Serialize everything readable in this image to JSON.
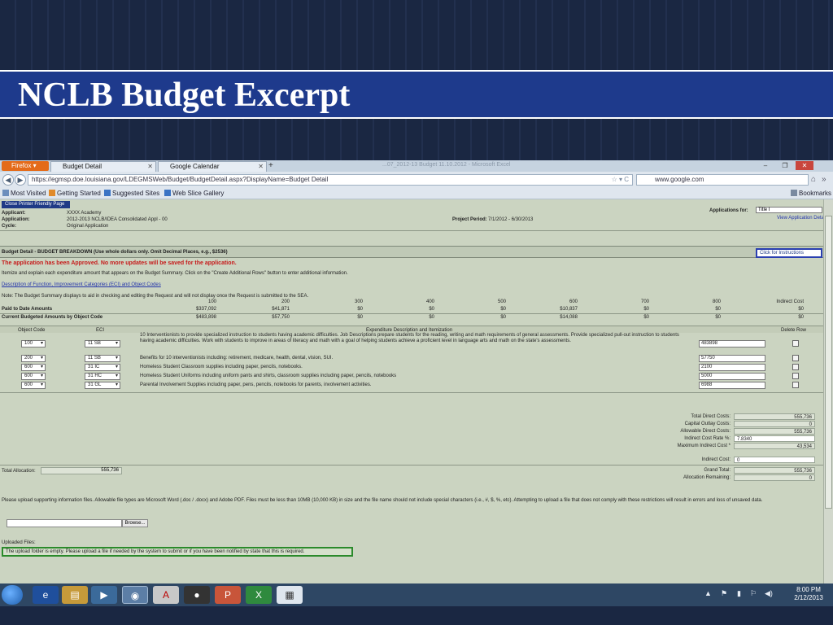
{
  "slide": {
    "title": "NCLB Budget Excerpt"
  },
  "browser": {
    "firefox_button": "Firefox",
    "tabs": [
      {
        "label": "Budget Detail"
      },
      {
        "label": "Google Calendar"
      }
    ],
    "new_tab": "+",
    "window_title": "...07_2012-13 Budget 11.10.2012 - Microsoft Excel",
    "controls": {
      "minimize": "–",
      "restore": "❐",
      "close": "✕"
    },
    "url": "https://egmsp.doe.louisiana.gov/LDEGMSWeb/Budget/BudgetDetail.aspx?DisplayName=Budget Detail",
    "search": "www.google.com",
    "bookmarks": [
      {
        "label": "Most Visited"
      },
      {
        "label": "Getting Started"
      },
      {
        "label": "Suggested Sites"
      },
      {
        "label": "Web Slice Gallery"
      }
    ],
    "bookmarks_menu": "Bookmarks"
  },
  "page": {
    "print_button": "Close Printer Friendly Page",
    "applicant_label": "Applicant:",
    "applicant_value": "XXXX Academy",
    "application_label": "Application:",
    "application_value": "2012-2013 NCLB/IDEA Consolidated Appl - 00",
    "cycle_label": "Cycle:",
    "cycle_value": "Original Application",
    "project_period_label": "Project Period:",
    "project_period_value": "7/1/2012 - 6/30/2013",
    "applications_for_label": "Applications for:",
    "applications_for_value": "Title I",
    "view_link": "View Application Details",
    "section_title": "Budget Detail   -   BUDGET BREAKDOWN (Use whole dollars only.  Omit Decimal Places, e.g., $2536)",
    "instructions_link": "Click for Instructions",
    "approved_msg": "The application has been Approved. No more updates will be saved for the application.",
    "instruction_text": "Itemize and explain each expenditure amount that appears on the Budget Summary.  Click on the \"Create Additional Rows\" button to enter additional information.",
    "description_link": "Description of Function, Improvement Categories (ECI) and Object Codes",
    "note_text": "Note: The Budget Summary displays to aid in checking and editing the Request and will not display once the Request is submitted to the SEA.",
    "object_codes": [
      "100",
      "200",
      "300",
      "400",
      "500",
      "600",
      "700",
      "800",
      "Indirect Cost"
    ],
    "paid_label": "Paid to Date Amounts",
    "paid_values": [
      "$337,092",
      "$41,871",
      "$0",
      "$0",
      "$0",
      "$10,837",
      "$0",
      "$0",
      "$0"
    ],
    "budgeted_label": "Current Budgeted Amounts by Object Code",
    "budgeted_values": [
      "$483,898",
      "$57,750",
      "$0",
      "$0",
      "$0",
      "$14,088",
      "$0",
      "$0",
      "$0"
    ],
    "table_headers": {
      "object_code": "Object Code",
      "eci": "ECI",
      "expenditure": "Expenditure Description and Itemization",
      "delete": "Delete Row"
    },
    "rows": [
      {
        "object": "100",
        "eci": "11 SB",
        "description": "10 Interventionists to provide specialized instruction to students having academic difficulties. Job Descriptions prepare students for the reading, writing and math requirements of general assessments. Provide specialized pull-out instruction to students having academic difficulties. Work with students to improve in areas of literacy and math with a goal of helping students achieve a proficient level in language arts and math on the state's assessments.",
        "amount": "483898"
      },
      {
        "object": "200",
        "eci": "11 SB",
        "description": "Benefits for 10 interventionists including: retirement, medicare, health, dental, vision, SUI.",
        "amount": "57750"
      },
      {
        "object": "600",
        "eci": "31 IC",
        "description": "Homeless Student Classroom supplies including paper, pencils, notebooks.",
        "amount": "2100"
      },
      {
        "object": "600",
        "eci": "31 HC",
        "description": "Homeless Student Uniforms including uniform pants and shirts, classroom supplies including paper, pencils, notebooks",
        "amount": "5000"
      },
      {
        "object": "600",
        "eci": "31 GL",
        "description": "Parental Involvement Supplies including paper, pens, pencils, notebooks for parents, involvement activities.",
        "amount": "6988"
      }
    ],
    "summary": [
      {
        "label": "Total Direct Costs:",
        "value": "555,736"
      },
      {
        "label": "Capital Outlay Costs:",
        "value": "0"
      },
      {
        "label": "Allowable Direct Costs:",
        "value": "555,736"
      },
      {
        "label": "Indirect Cost Rate %:",
        "value": "7.8340"
      },
      {
        "label": "Maximum Indirect Cost *",
        "value": "43,534"
      }
    ],
    "indirect_label": "Indirect Cost:",
    "indirect_value": "0",
    "total_allocation_label": "Total Allocation:",
    "total_allocation_value": "555,736",
    "grand_total_label": "Grand Total:",
    "grand_total_value": "555,736",
    "allocation_remaining_label": "Allocation Remaining:",
    "allocation_remaining_value": "0",
    "upload_instructions": "Please upload supporting information files. Allowable file types are Microsoft Word (.doc / .docx) and Adobe PDF. Files must be less than 10MB (10,000 KB) in size and the file name should not include special characters (i.e., #, $, %, etc). Attempting to upload a file that does not comply with these restrictions will result in errors and loss of unsaved data.",
    "browse_button": "Browse...",
    "uploaded_label": "Uploaded Files:",
    "upload_notice": "The upload folder is empty. Please upload a file if needed by the system to submit or if you have been notified by state that this is required."
  },
  "taskbar": {
    "clock_time": "8:00 PM",
    "clock_date": "2/12/2013"
  }
}
